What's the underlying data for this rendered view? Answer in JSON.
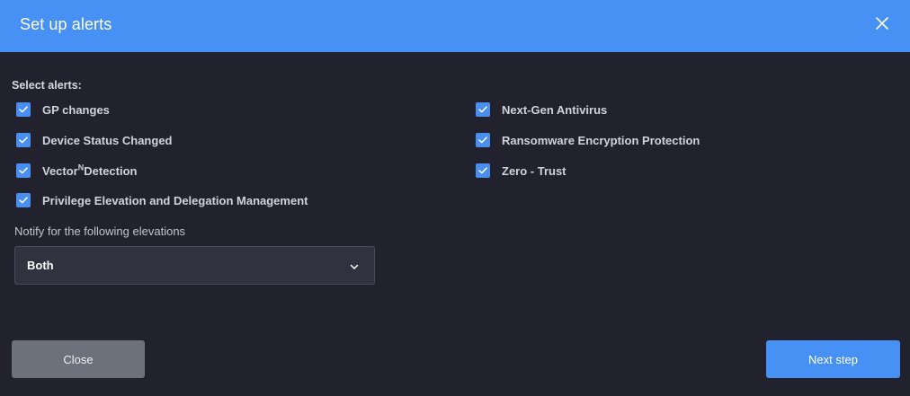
{
  "dialog": {
    "title": "Set up alerts",
    "close_icon": "close-icon"
  },
  "alerts": {
    "section_label": "Select alerts:",
    "items": [
      {
        "id": "gp-changes",
        "label": "GP changes",
        "checked": true
      },
      {
        "id": "device-status-changed",
        "label": "Device Status Changed",
        "checked": true
      },
      {
        "id": "vector-detection",
        "label_prefix": "Vector",
        "label_sup": "N",
        "label_suffix": "Detection",
        "checked": true
      },
      {
        "id": "privilege-elevation",
        "label": "Privilege Elevation and Delegation Management",
        "checked": true
      },
      {
        "id": "next-gen-antivirus",
        "label": "Next-Gen Antivirus",
        "checked": true
      },
      {
        "id": "ransomware-encryption",
        "label": "Ransomware Encryption Protection",
        "checked": true
      },
      {
        "id": "zero-trust",
        "label": "Zero - Trust",
        "checked": true
      }
    ]
  },
  "notify": {
    "label": "Notify for the following elevations",
    "selected": "Both",
    "chevron_icon": "chevron-down-icon"
  },
  "footer": {
    "close_label": "Close",
    "next_label": "Next step"
  },
  "colors": {
    "header": "#4891f4",
    "background": "#22222f",
    "checkbox": "#4a8ff0",
    "primary_button": "#4891f4",
    "secondary_button": "#6c717c"
  }
}
